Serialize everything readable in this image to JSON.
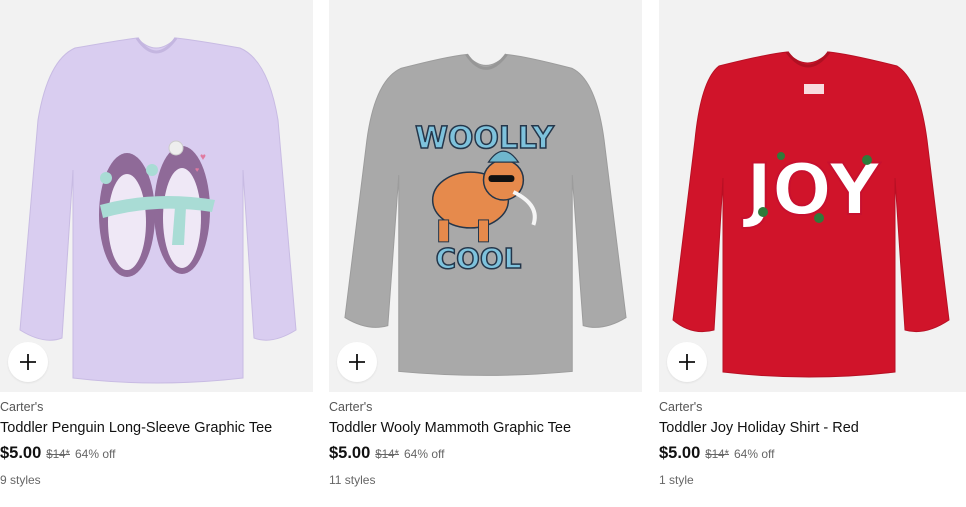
{
  "products": [
    {
      "brand": "Carter's",
      "title": "Toddler Penguin Long-Sleeve Graphic Tee",
      "price": "$5.00",
      "original_price": "$14*",
      "discount": "64% off",
      "styles": "9 styles",
      "shirt_color": "#d9cdf0",
      "graphic": "penguins"
    },
    {
      "brand": "Carter's",
      "title": "Toddler Wooly Mammoth Graphic Tee",
      "price": "$5.00",
      "original_price": "$14*",
      "discount": "64% off",
      "styles": "11 styles",
      "shirt_color": "#a9a9a9",
      "graphic": "mammoth",
      "graphic_text_top": "WOOLLY",
      "graphic_text_bottom": "COOL"
    },
    {
      "brand": "Carter's",
      "title": "Toddler Joy Holiday Shirt - Red",
      "price": "$5.00",
      "original_price": "$14*",
      "discount": "64% off",
      "styles": "1 style",
      "shirt_color": "#d0142a",
      "graphic": "joy",
      "graphic_text": "JOY"
    }
  ],
  "add_icon": "plus-icon"
}
